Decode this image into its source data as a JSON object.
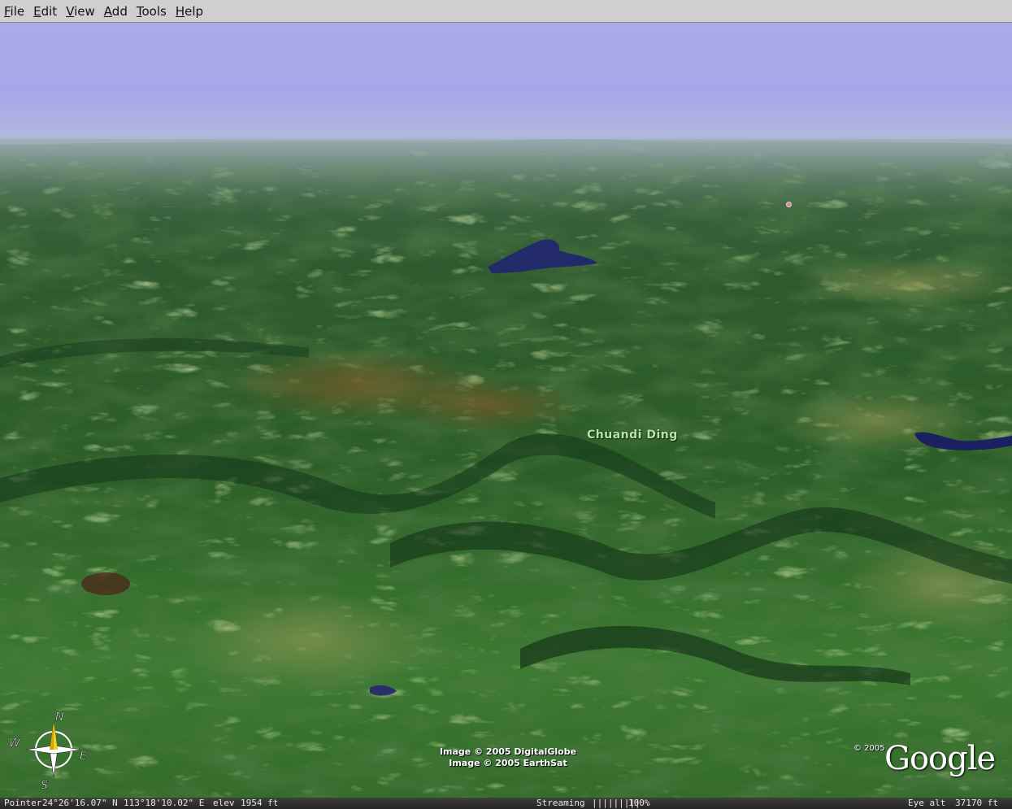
{
  "menu": {
    "items": [
      "File",
      "Edit",
      "View",
      "Add",
      "Tools",
      "Help"
    ],
    "underline_index": [
      0,
      0,
      0,
      0,
      0,
      0
    ]
  },
  "map": {
    "place_label": "Chuandi Ding",
    "imagery_credits": [
      "Image © 2005 DigitalGlobe",
      "Image © 2005 EarthSat"
    ],
    "copyright": "© 2005",
    "logo_text": "Google"
  },
  "compass": {
    "north": "N",
    "south": "S",
    "east": "E",
    "west": "W"
  },
  "status": {
    "pointer_label": "Pointer",
    "latitude": "24°26'16.07\" N",
    "longitude": "113°18'10.02\" E",
    "elev_label": "elev",
    "elevation": "1954 ft",
    "streaming_label": "Streaming",
    "streaming_bars": "|||||||||",
    "streaming_percent": "100%",
    "eye_alt_label": "Eye  alt",
    "eye_alt": "37170 ft"
  },
  "colors": {
    "sky": "#a6a7ea",
    "terrain_dark": "#1e4a24",
    "terrain_mid": "#3d7a35",
    "terrain_light": "#6c9a4a",
    "water": "#1d1f5a",
    "label": "#b8e3a6"
  }
}
